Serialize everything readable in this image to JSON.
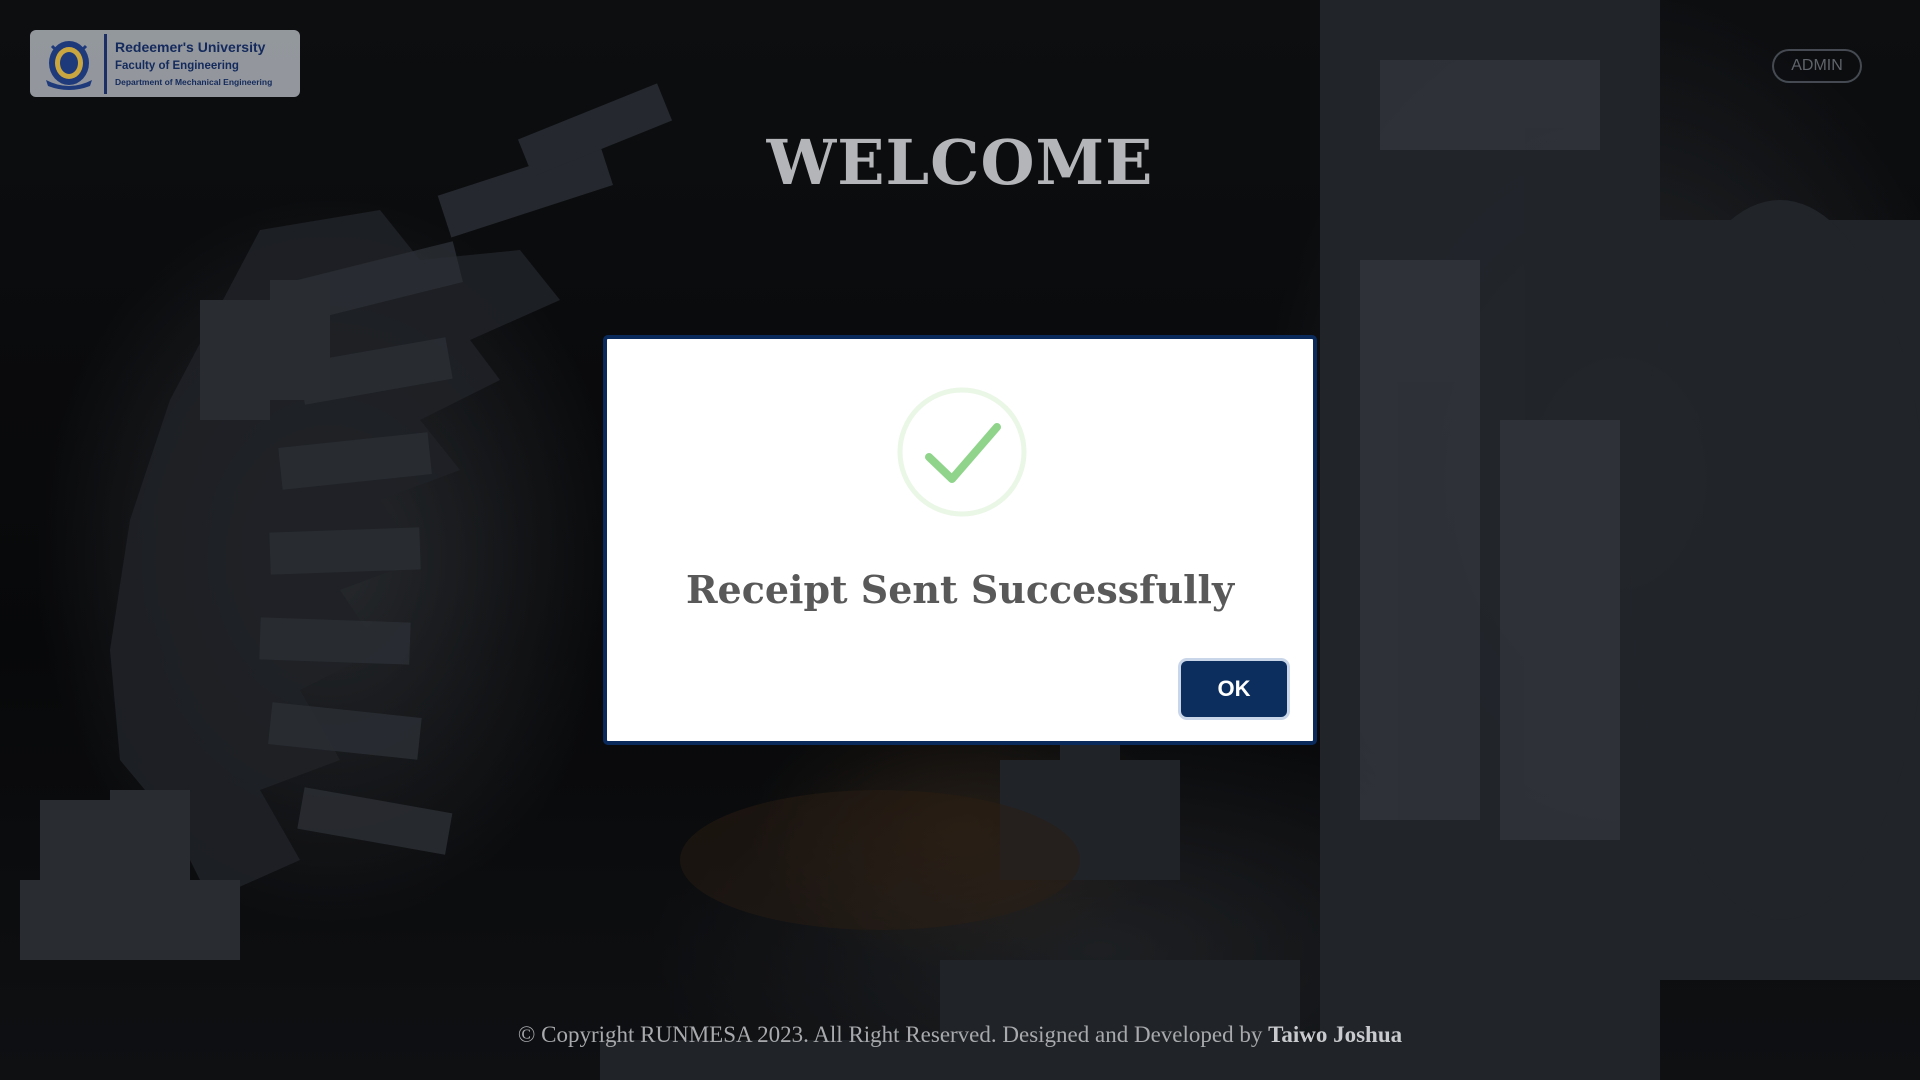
{
  "header": {
    "logo": {
      "university": "Redeemer's University",
      "faculty": "Faculty of Engineering",
      "department": "Department of Mechanical Engineering"
    },
    "admin_label": "ADMIN",
    "welcome": "WELCOME"
  },
  "modal": {
    "icon": "check-circle-icon",
    "title": "Receipt Sent Successfully",
    "ok_label": "OK"
  },
  "footer": {
    "copyright": "© Copyright RUNMESA 2023. All Right Reserved. Designed and Developed by",
    "author": "Taiwo Joshua"
  },
  "colors": {
    "modal_border": "#0a2a5c",
    "ok_button": "#0b2e5e",
    "success_check": "#8fd48f",
    "logo_text": "#142a5c"
  }
}
